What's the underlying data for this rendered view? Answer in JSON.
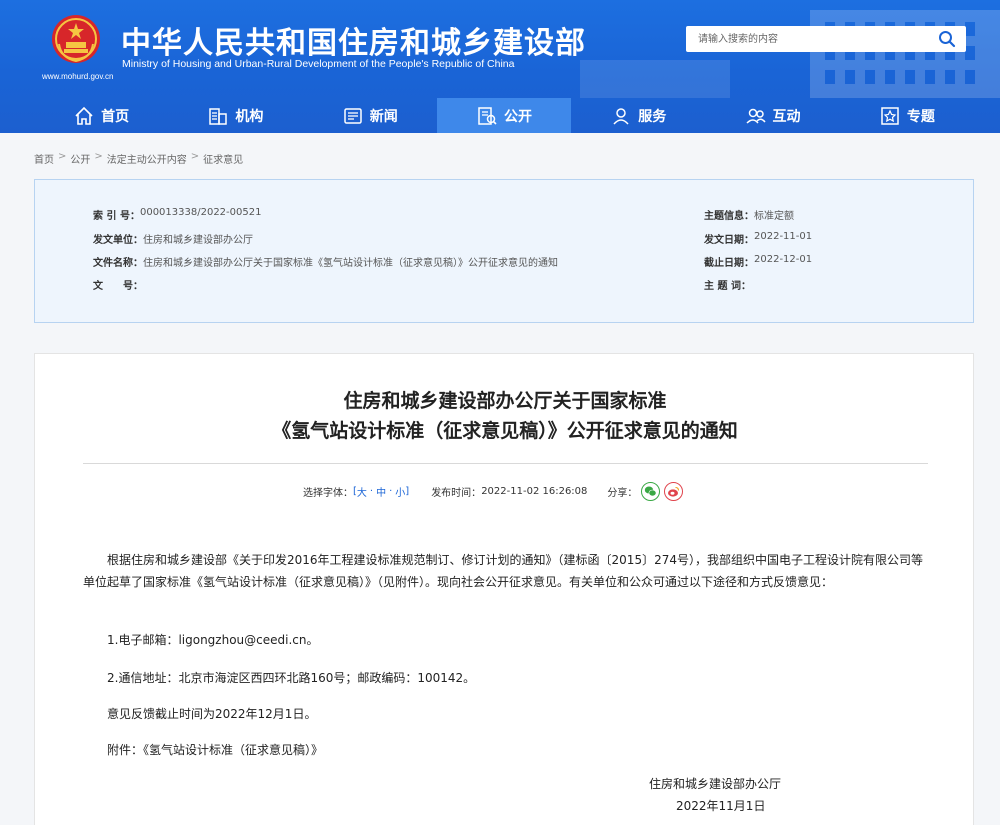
{
  "header": {
    "site_url": "www.mohurd.gov.cn",
    "title": "中华人民共和国住房和城乡建设部",
    "subtitle": "Ministry of Housing and Urban-Rural Development of the People's Republic of China",
    "search_placeholder": "请输入搜索的内容"
  },
  "nav": {
    "items": [
      {
        "label": "首页",
        "icon": "home-icon"
      },
      {
        "label": "机构",
        "icon": "organization-icon"
      },
      {
        "label": "新闻",
        "icon": "news-icon"
      },
      {
        "label": "公开",
        "icon": "disclosure-icon",
        "active": true
      },
      {
        "label": "服务",
        "icon": "service-icon"
      },
      {
        "label": "互动",
        "icon": "interaction-icon"
      },
      {
        "label": "专题",
        "icon": "topic-icon"
      }
    ]
  },
  "breadcrumb": {
    "items": [
      "首页",
      "公开",
      "法定主动公开内容",
      "征求意见"
    ],
    "separator": ">"
  },
  "info": {
    "index_label": "索 引 号：",
    "index_value": "000013338/2022-00521",
    "issuer_label": "发文单位：",
    "issuer_value": "住房和城乡建设部办公厅",
    "docname_label": "文件名称：",
    "docname_value": "住房和城乡建设部办公厅关于国家标准《氢气站设计标准（征求意见稿）》公开征求意见的通知",
    "docno_label": "文　　号：",
    "docno_value": "",
    "topic_label": "主题信息：",
    "topic_value": "标准定额",
    "issue_date_label": "发文日期：",
    "issue_date_value": "2022-11-01",
    "deadline_label": "截止日期：",
    "deadline_value": "2022-12-01",
    "keywords_label": "主 题 词：",
    "keywords_value": ""
  },
  "article": {
    "title_line1": "住房和城乡建设部办公厅关于国家标准",
    "title_line2": "《氢气站设计标准（征求意见稿）》公开征求意见的通知",
    "font_select_label": "选择字体：",
    "font_bracket_open": "[",
    "font_large": "大",
    "font_medium": "中",
    "font_small": "小",
    "font_dot": "·",
    "font_bracket_close": "]",
    "publish_label": "发布时间：",
    "publish_time": "2022-11-02 16:26:08",
    "share_label": "分享：",
    "paragraph1": "根据住房和城乡建设部《关于印发2016年工程建设标准规范制订、修订计划的通知》（建标函〔2015〕274号），我部组织中国电子工程设计院有限公司等单位起草了国家标准《氢气站设计标准（征求意见稿）》（见附件）。现向社会公开征求意见。有关单位和公众可通过以下途径和方式反馈意见：",
    "paragraph2": "1.电子邮箱：ligongzhou@ceedi.cn。",
    "paragraph3": "2.通信地址：北京市海淀区西四环北路160号；邮政编码：100142。",
    "paragraph4": "意见反馈截止时间为2022年12月1日。",
    "attachment_label": "附件：",
    "attachment_link": "《氢气站设计标准（征求意见稿）》",
    "signature_org": "住房和城乡建设部办公厅",
    "signature_date": "2022年11月1日"
  },
  "colors": {
    "header_blue": "#1a64d6",
    "nav_active": "#3e88ea",
    "link_blue": "#1a64d6"
  }
}
